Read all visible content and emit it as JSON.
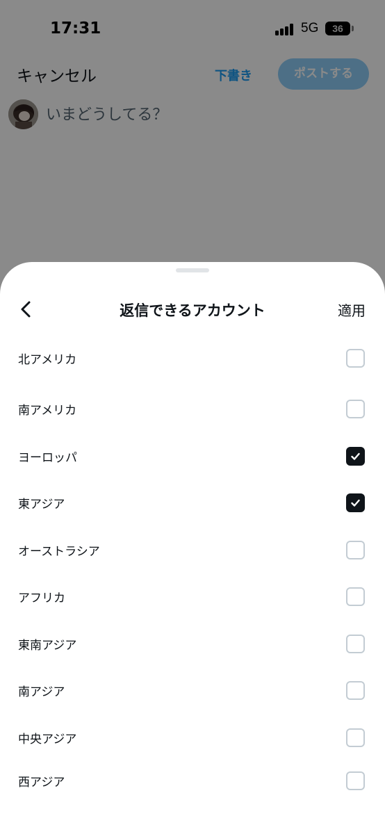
{
  "status_bar": {
    "time": "17:31",
    "network": "5G",
    "battery_level": "36"
  },
  "compose": {
    "cancel_label": "キャンセル",
    "draft_label": "下書き",
    "post_label": "ポストする",
    "placeholder": "いまどうしてる？"
  },
  "sheet": {
    "title": "返信できるアカウント",
    "apply_label": "適用",
    "regions": [
      {
        "label": "北アメリカ",
        "checked": false
      },
      {
        "label": "南アメリカ",
        "checked": false
      },
      {
        "label": "ヨーロッパ",
        "checked": true
      },
      {
        "label": "東アジア",
        "checked": true
      },
      {
        "label": "オーストラシア",
        "checked": false
      },
      {
        "label": "アフリカ",
        "checked": false
      },
      {
        "label": "東南アジア",
        "checked": false
      },
      {
        "label": "南アジア",
        "checked": false
      },
      {
        "label": "中央アジア",
        "checked": false
      },
      {
        "label": "西アジア",
        "checked": false
      }
    ]
  },
  "colors": {
    "accent": "#1d9bf0",
    "post_button_disabled": "#8ecdf8",
    "text_primary": "#0f1419",
    "checkbox_checked": "#0f1419",
    "checkbox_border": "#c3ccd3"
  }
}
